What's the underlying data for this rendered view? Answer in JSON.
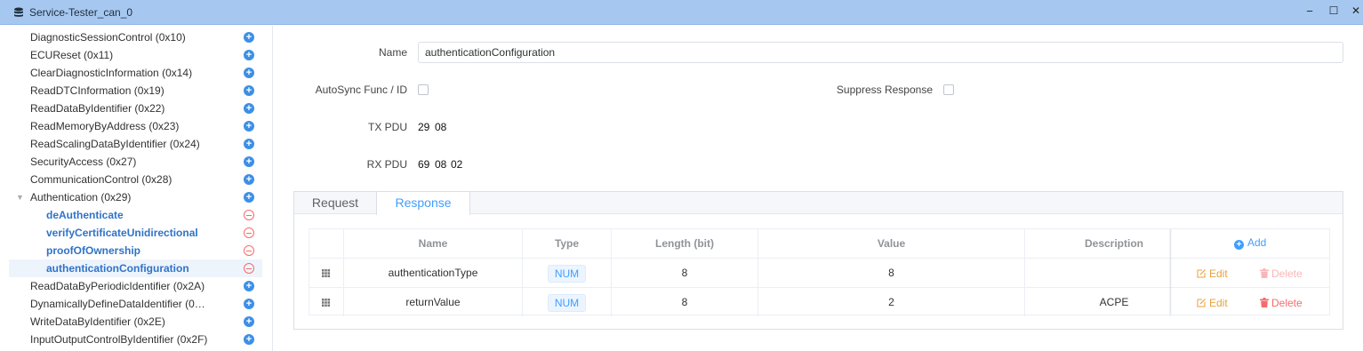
{
  "window": {
    "title": "Service-Tester_can_0",
    "controls": {
      "minimize": "−",
      "maximize": "☐",
      "close": "✕"
    }
  },
  "sidebar": {
    "items": [
      {
        "label": "DiagnosticSessionControl (0x10)",
        "action": "add"
      },
      {
        "label": "ECUReset (0x11)",
        "action": "add"
      },
      {
        "label": "ClearDiagnosticInformation (0x14)",
        "action": "add"
      },
      {
        "label": "ReadDTCInformation (0x19)",
        "action": "add"
      },
      {
        "label": "ReadDataByIdentifier (0x22)",
        "action": "add"
      },
      {
        "label": "ReadMemoryByAddress (0x23)",
        "action": "add"
      },
      {
        "label": "ReadScalingDataByIdentifier (0x24)",
        "action": "add"
      },
      {
        "label": "SecurityAccess (0x27)",
        "action": "add"
      },
      {
        "label": "CommunicationControl (0x28)",
        "action": "add"
      },
      {
        "label": "Authentication (0x29)",
        "action": "add",
        "expanded": true
      },
      {
        "label": "deAuthenticate",
        "action": "remove",
        "child": true
      },
      {
        "label": "verifyCertificateUnidirectional",
        "action": "remove",
        "child": true
      },
      {
        "label": "proofOfOwnership",
        "action": "remove",
        "child": true
      },
      {
        "label": "authenticationConfiguration",
        "action": "remove",
        "child": true,
        "selected": true
      },
      {
        "label": "ReadDataByPeriodicIdentifier (0x2A)",
        "action": "add"
      },
      {
        "label": "DynamicallyDefineDataIdentifier (0…",
        "action": "add"
      },
      {
        "label": "WriteDataByIdentifier (0x2E)",
        "action": "add"
      },
      {
        "label": "InputOutputControlByIdentifier (0x2F)",
        "action": "add"
      }
    ]
  },
  "form": {
    "name_label": "Name",
    "name_value": "authenticationConfiguration",
    "autosync_label": "AutoSync Func / ID",
    "autosync_checked": false,
    "suppress_label": "Suppress Response",
    "suppress_checked": false,
    "tx_label": "TX PDU",
    "tx_bytes": [
      "29",
      "08"
    ],
    "rx_label": "RX PDU",
    "rx_bytes": [
      "69",
      "08",
      "02"
    ]
  },
  "tabs": [
    {
      "label": "Request",
      "active": false
    },
    {
      "label": "Response",
      "active": true
    }
  ],
  "table": {
    "headers": {
      "name": "Name",
      "type": "Type",
      "length": "Length (bit)",
      "value": "Value",
      "description": "Description"
    },
    "add_label": "Add",
    "edit_label": "Edit",
    "delete_label": "Delete",
    "rows": [
      {
        "name": "authenticationType",
        "type": "NUM",
        "length": "8",
        "value": "8",
        "description": "",
        "delete_enabled": false
      },
      {
        "name": "returnValue",
        "type": "NUM",
        "length": "8",
        "value": "2",
        "description": "ACPE",
        "delete_enabled": true
      }
    ]
  },
  "colors": {
    "titlebar": "#a6c8f0",
    "accent": "#409eff",
    "edit": "#e6a23c",
    "delete": "#f56c6c"
  }
}
